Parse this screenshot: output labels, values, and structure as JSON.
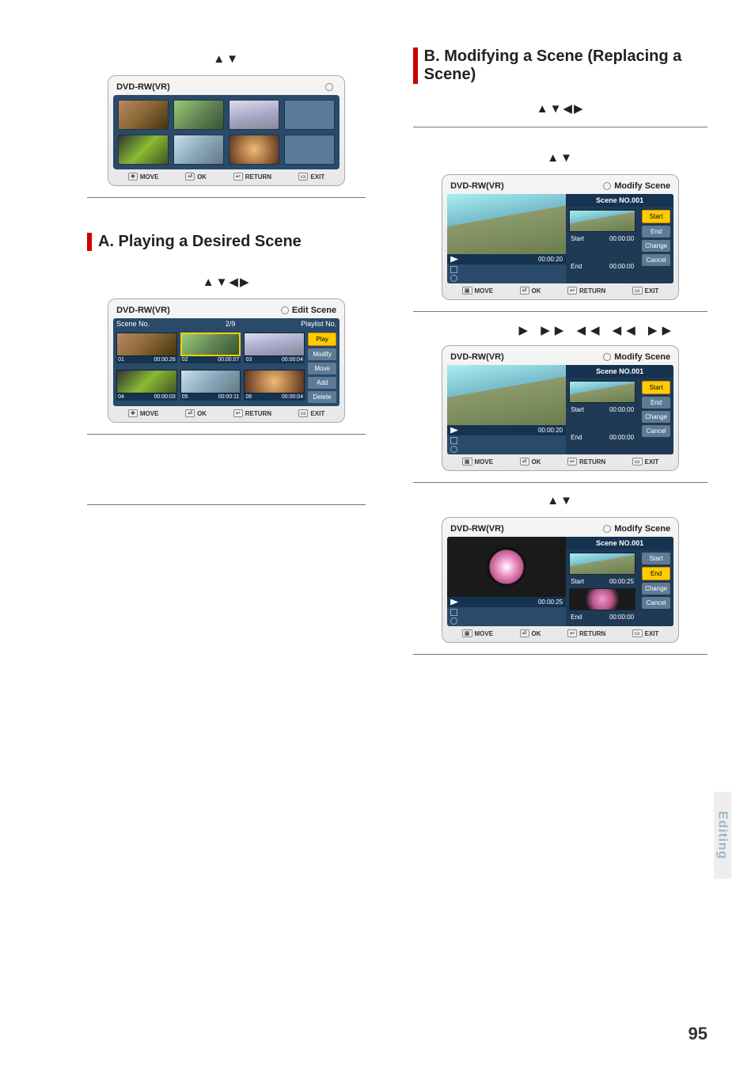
{
  "page_number": "95",
  "side_tab": "Editing",
  "left": {
    "arrows_top": "▲▼",
    "osd_playlist": {
      "disc": "DVD-RW(VR)",
      "title_right": "",
      "footer": {
        "move": "MOVE",
        "ok": "OK",
        "return": "RETURN",
        "exit": "EXIT"
      }
    },
    "heading_a": "A. Playing a Desired Scene",
    "arrows_a": "▲▼◀▶",
    "osd_editscene": {
      "disc": "DVD-RW(VR)",
      "title_right": "Edit Scene",
      "hdr": {
        "scene_no": "Scene No.",
        "count": "2/9",
        "playlist_no": "Playlist No."
      },
      "thumbs": [
        {
          "no": "01",
          "t": "00:00:26"
        },
        {
          "no": "02",
          "t": "00:00:07"
        },
        {
          "no": "03",
          "t": "00:00:04"
        },
        {
          "no": "04",
          "t": "00:00:03"
        },
        {
          "no": "05",
          "t": "00:00:11"
        },
        {
          "no": "06",
          "t": "00:00:04"
        }
      ],
      "side": {
        "play": "Play",
        "modify": "Modify",
        "move": "Move",
        "add": "Add",
        "del": "Delete"
      },
      "footer": {
        "move": "MOVE",
        "ok": "OK",
        "return": "RETURN",
        "exit": "EXIT"
      }
    }
  },
  "right": {
    "heading_b": "B. Modifying a Scene (Replacing a Scene)",
    "arrows_b1": "▲▼◀▶",
    "arrows_b2": "▲▼",
    "osd_mod1": {
      "disc": "DVD-RW(VR)",
      "title_right": "Modify Scene",
      "scene": "Scene NO.001",
      "playtime": "00:00:20",
      "start_label": "Start",
      "start_time": "00:00:00",
      "end_label": "End",
      "end_time": "00:00:00",
      "side": {
        "start": "Start",
        "end": "End",
        "change": "Change",
        "cancel": "Cancel"
      },
      "sel": "start",
      "footer": {
        "move": "MOVE",
        "ok": "OK",
        "return": "RETURN",
        "exit": "EXIT"
      }
    },
    "play_icons": "▶  ▶▶  ◀◀ ◀◀  ▶▶",
    "osd_mod2": {
      "disc": "DVD-RW(VR)",
      "title_right": "Modify Scene",
      "scene": "Scene NO.001",
      "playtime": "00:00:20",
      "start_label": "Start",
      "start_time": "00:00:00",
      "end_label": "End",
      "end_time": "00:00:00",
      "side": {
        "start": "Start",
        "end": "End",
        "change": "Change",
        "cancel": "Cancel"
      },
      "sel": "start",
      "footer": {
        "move": "MOVE",
        "ok": "OK",
        "return": "RETURN",
        "exit": "EXIT"
      }
    },
    "arrows_b3": "▲▼",
    "osd_mod3": {
      "disc": "DVD-RW(VR)",
      "title_right": "Modify Scene",
      "scene": "Scene NO.001",
      "playtime": "00:00:25",
      "start_label": "Start",
      "start_time": "00:00:25",
      "end_label": "End",
      "end_time": "00:00:00",
      "side": {
        "start": "Start",
        "end": "End",
        "change": "Change",
        "cancel": "Cancel"
      },
      "sel": "end",
      "dark": true,
      "footer": {
        "move": "MOVE",
        "ok": "OK",
        "return": "RETURN",
        "exit": "EXIT"
      }
    }
  }
}
